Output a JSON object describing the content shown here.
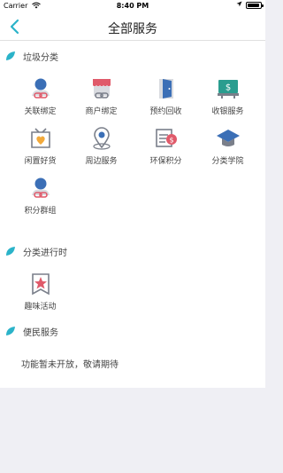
{
  "status_bar": {
    "carrier": "Carrier",
    "time": "8:40 PM",
    "battery_level": 0.9
  },
  "nav": {
    "title": "全部服务"
  },
  "sections": [
    {
      "title": "垃圾分类",
      "items": [
        {
          "label": "关联绑定",
          "icon": "user-link-icon"
        },
        {
          "label": "商户绑定",
          "icon": "shop-link-icon"
        },
        {
          "label": "预约回收",
          "icon": "door-icon"
        },
        {
          "label": "收银服务",
          "icon": "cashier-icon"
        },
        {
          "label": "闲置好货",
          "icon": "gift-box-icon"
        },
        {
          "label": "周边服务",
          "icon": "location-pin-icon"
        },
        {
          "label": "环保积分",
          "icon": "points-icon"
        },
        {
          "label": "分类学院",
          "icon": "graduation-cap-icon"
        },
        {
          "label": "积分群组",
          "icon": "group-link-icon"
        }
      ]
    },
    {
      "title": "分类进行时",
      "items": [
        {
          "label": "趣味活动",
          "icon": "star-badge-icon"
        }
      ]
    },
    {
      "title": "便民服务",
      "notice": "功能暂未开放，敬请期待"
    }
  ],
  "colors": {
    "accent": "#2bb3c9",
    "icon_blue": "#3b6fb6",
    "icon_red": "#e05a6a",
    "icon_teal": "#2a9d8f",
    "icon_orange": "#f2a93b",
    "icon_gray": "#7a7f8a"
  }
}
